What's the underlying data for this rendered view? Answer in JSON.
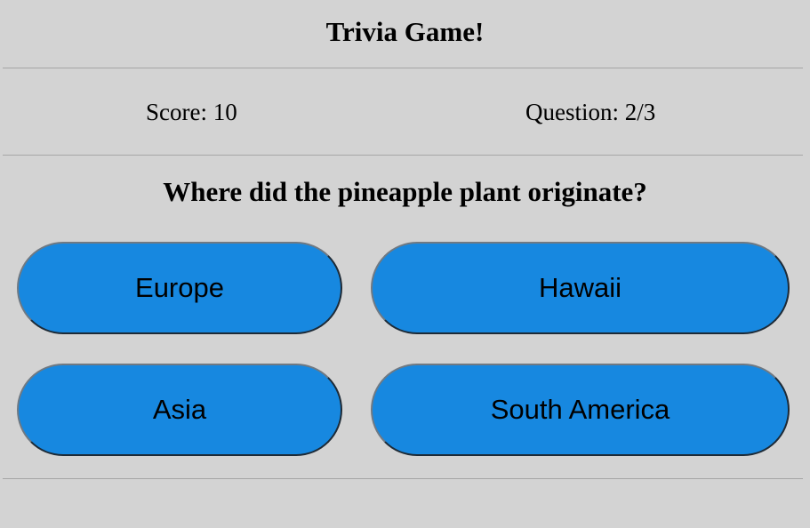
{
  "header": {
    "title": "Trivia Game!"
  },
  "status": {
    "score_label": "Score: 10",
    "question_label": "Question: 2/3"
  },
  "question": {
    "text": "Where did the pineapple plant originate?"
  },
  "answers": [
    {
      "label": "Europe"
    },
    {
      "label": "Hawaii"
    },
    {
      "label": "Asia"
    },
    {
      "label": "South America"
    }
  ],
  "colors": {
    "background": "#d3d3d3",
    "answer_button": "#1788e0",
    "divider": "#a6a6a6"
  }
}
